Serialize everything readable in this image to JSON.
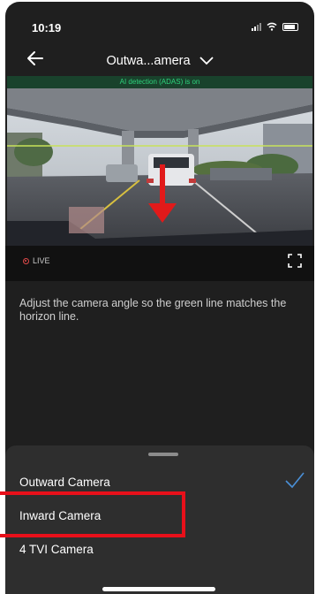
{
  "status_bar": {
    "time": "10:19"
  },
  "header": {
    "title": "Outwa...amera"
  },
  "camera": {
    "ai_banner": "AI detection (ADAS) is on",
    "live_label": "LIVE"
  },
  "instructions": "Adjust the camera angle so the green line matches the horizon line.",
  "camera_menu": {
    "options": [
      "Outward Camera",
      "Inward Camera",
      "4 TVI Camera"
    ],
    "selected": "Outward Camera",
    "highlighted": "Inward Camera"
  },
  "colors": {
    "ai_banner_text": "#2ed37d",
    "highlight_border": "#e8101a",
    "check_accent": "#4a8fd6",
    "arrow": "#e11a1a"
  }
}
